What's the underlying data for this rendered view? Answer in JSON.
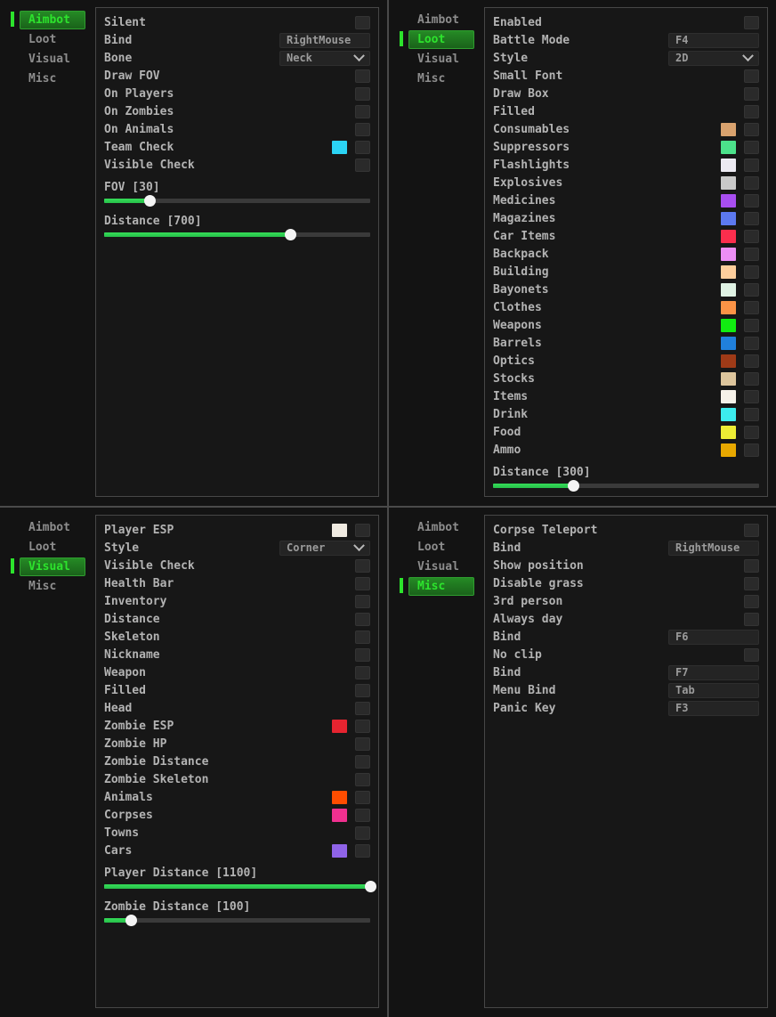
{
  "theme": {
    "accent_green": "#2ce32c",
    "slider_fill": "#2cd451",
    "slider_handle": "#f4f4f4",
    "panel_border": "#474747"
  },
  "panels": [
    {
      "id": "aimbot",
      "tabs": [
        {
          "label": "Aimbot",
          "active": true
        },
        {
          "label": "Loot",
          "active": false
        },
        {
          "label": "Visual",
          "active": false
        },
        {
          "label": "Misc",
          "active": false
        }
      ],
      "rows": [
        {
          "type": "toggle",
          "label": "Silent"
        },
        {
          "type": "input",
          "label": "Bind",
          "value": "RightMouse"
        },
        {
          "type": "select",
          "label": "Bone",
          "value": "Neck"
        },
        {
          "type": "toggle",
          "label": "Draw FOV"
        },
        {
          "type": "toggle",
          "label": "On Players"
        },
        {
          "type": "toggle",
          "label": "On Zombies"
        },
        {
          "type": "toggle",
          "label": "On Animals"
        },
        {
          "type": "color",
          "label": "Team Check",
          "swatch": "#2bd4f5"
        },
        {
          "type": "toggle",
          "label": "Visible Check"
        },
        {
          "type": "slider",
          "label": "FOV [30]",
          "pct": 17
        },
        {
          "type": "slider",
          "label": "Distance [700]",
          "pct": 70
        }
      ]
    },
    {
      "id": "loot",
      "tabs": [
        {
          "label": "Aimbot",
          "active": false
        },
        {
          "label": "Loot",
          "active": true
        },
        {
          "label": "Visual",
          "active": false
        },
        {
          "label": "Misc",
          "active": false
        }
      ],
      "rows": [
        {
          "type": "toggle",
          "label": "Enabled"
        },
        {
          "type": "input",
          "label": "Battle Mode",
          "value": "F4"
        },
        {
          "type": "select",
          "label": "Style",
          "value": "2D"
        },
        {
          "type": "toggle",
          "label": "Small Font"
        },
        {
          "type": "toggle",
          "label": "Draw Box"
        },
        {
          "type": "toggle",
          "label": "Filled"
        },
        {
          "type": "color",
          "label": "Consumables",
          "swatch": "#d9a26e"
        },
        {
          "type": "color",
          "label": "Suppressors",
          "swatch": "#4ce28b"
        },
        {
          "type": "color",
          "label": "Flashlights",
          "swatch": "#eceaf2"
        },
        {
          "type": "color",
          "label": "Explosives",
          "swatch": "#c9c9c9"
        },
        {
          "type": "color",
          "label": "Medicines",
          "swatch": "#a84ef0"
        },
        {
          "type": "color",
          "label": "Magazines",
          "swatch": "#5c79f0"
        },
        {
          "type": "color",
          "label": "Car Items",
          "swatch": "#fb2e4d"
        },
        {
          "type": "color",
          "label": "Backpack",
          "swatch": "#ec8ef5"
        },
        {
          "type": "color",
          "label": "Building",
          "swatch": "#fdce9c"
        },
        {
          "type": "color",
          "label": "Bayonets",
          "swatch": "#dff2e4"
        },
        {
          "type": "color",
          "label": "Clothes",
          "swatch": "#fb9346"
        },
        {
          "type": "color",
          "label": "Weapons",
          "swatch": "#11ed11"
        },
        {
          "type": "color",
          "label": "Barrels",
          "swatch": "#2080dc"
        },
        {
          "type": "color",
          "label": "Optics",
          "swatch": "#9e3a17"
        },
        {
          "type": "color",
          "label": "Stocks",
          "swatch": "#ddc59c"
        },
        {
          "type": "color",
          "label": "Items",
          "swatch": "#f6f1e9"
        },
        {
          "type": "color",
          "label": "Drink",
          "swatch": "#3cecee"
        },
        {
          "type": "color",
          "label": "Food",
          "swatch": "#eded35"
        },
        {
          "type": "color",
          "label": "Ammo",
          "swatch": "#e8a800"
        },
        {
          "type": "slider",
          "label": "Distance [300]",
          "pct": 30
        }
      ]
    },
    {
      "id": "visual",
      "tabs": [
        {
          "label": "Aimbot",
          "active": false
        },
        {
          "label": "Loot",
          "active": false
        },
        {
          "label": "Visual",
          "active": true
        },
        {
          "label": "Misc",
          "active": false
        }
      ],
      "rows": [
        {
          "type": "color",
          "label": "Player ESP",
          "swatch": "#efeae1"
        },
        {
          "type": "select",
          "label": "Style",
          "value": "Corner"
        },
        {
          "type": "toggle",
          "label": "Visible Check"
        },
        {
          "type": "toggle",
          "label": "Health Bar"
        },
        {
          "type": "toggle",
          "label": "Inventory"
        },
        {
          "type": "toggle",
          "label": "Distance"
        },
        {
          "type": "toggle",
          "label": "Skeleton"
        },
        {
          "type": "toggle",
          "label": "Nickname"
        },
        {
          "type": "toggle",
          "label": "Weapon"
        },
        {
          "type": "toggle",
          "label": "Filled"
        },
        {
          "type": "toggle",
          "label": "Head"
        },
        {
          "type": "color",
          "label": "Zombie ESP",
          "swatch": "#e62430"
        },
        {
          "type": "toggle",
          "label": "Zombie HP"
        },
        {
          "type": "toggle",
          "label": "Zombie Distance"
        },
        {
          "type": "toggle",
          "label": "Zombie Skeleton"
        },
        {
          "type": "color",
          "label": "Animals",
          "swatch": "#ff4d00"
        },
        {
          "type": "color",
          "label": "Corpses",
          "swatch": "#f0308f"
        },
        {
          "type": "toggle",
          "label": "Towns"
        },
        {
          "type": "color",
          "label": "Cars",
          "swatch": "#8f63e8"
        },
        {
          "type": "slider",
          "label": "Player Distance [1100]",
          "pct": 100
        },
        {
          "type": "slider",
          "label": "Zombie Distance [100]",
          "pct": 10
        }
      ]
    },
    {
      "id": "misc",
      "tabs": [
        {
          "label": "Aimbot",
          "active": false
        },
        {
          "label": "Loot",
          "active": false
        },
        {
          "label": "Visual",
          "active": false
        },
        {
          "label": "Misc",
          "active": true
        }
      ],
      "rows": [
        {
          "type": "toggle",
          "label": "Corpse Teleport"
        },
        {
          "type": "input",
          "label": "Bind",
          "value": "RightMouse"
        },
        {
          "type": "toggle",
          "label": "Show position"
        },
        {
          "type": "toggle",
          "label": "Disable grass"
        },
        {
          "type": "toggle",
          "label": "3rd person"
        },
        {
          "type": "toggle",
          "label": "Always day"
        },
        {
          "type": "input",
          "label": "Bind",
          "value": "F6"
        },
        {
          "type": "toggle",
          "label": "No clip"
        },
        {
          "type": "input",
          "label": "Bind",
          "value": "F7"
        },
        {
          "type": "input",
          "label": "Menu Bind",
          "value": "Tab"
        },
        {
          "type": "input",
          "label": "Panic Key",
          "value": "F3"
        }
      ]
    }
  ]
}
